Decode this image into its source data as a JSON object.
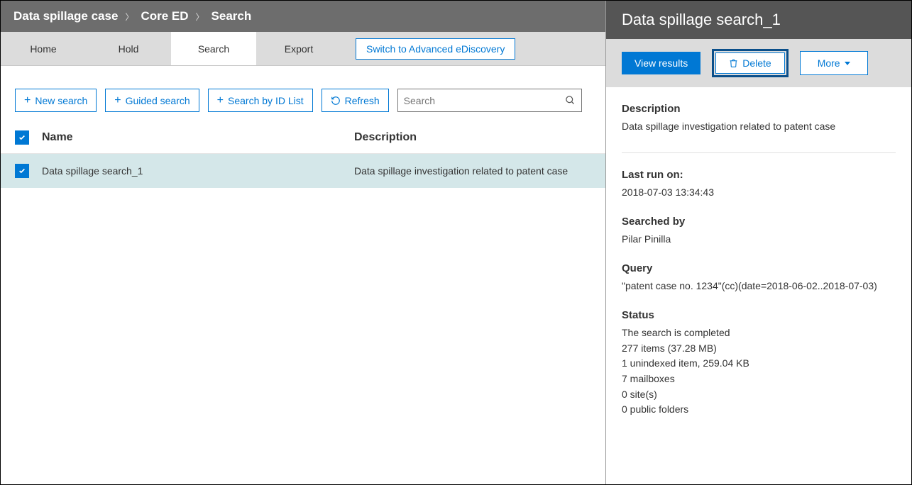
{
  "breadcrumb": [
    "Data spillage case",
    "Core ED",
    "Search"
  ],
  "tabs": {
    "items": [
      "Home",
      "Hold",
      "Search",
      "Export"
    ],
    "active": "Search",
    "advanced_label": "Switch to Advanced eDiscovery"
  },
  "toolbar": {
    "new_search": "New search",
    "guided_search": "Guided search",
    "search_by_id": "Search by ID List",
    "refresh": "Refresh",
    "search_placeholder": "Search"
  },
  "table": {
    "header_name": "Name",
    "header_desc": "Description",
    "rows": [
      {
        "name": "Data spillage search_1",
        "desc": "Data spillage investigation related to patent case"
      }
    ]
  },
  "detail": {
    "title": "Data spillage search_1",
    "actions": {
      "view_results": "View results",
      "delete": "Delete",
      "more": "More"
    },
    "description_label": "Description",
    "description_value": "Data spillage investigation related to patent case",
    "last_run_label": "Last run on:",
    "last_run_value": "2018-07-03 13:34:43",
    "searched_by_label": "Searched by",
    "searched_by_value": "Pilar Pinilla",
    "query_label": "Query",
    "query_value": "\"patent case no. 1234\"(cc)(date=2018-06-02..2018-07-03)",
    "status_label": "Status",
    "status_lines": [
      "The search is completed",
      "277 items (37.28 MB)",
      "1 unindexed item, 259.04 KB",
      "7 mailboxes",
      "0 site(s)",
      "0 public folders"
    ]
  }
}
